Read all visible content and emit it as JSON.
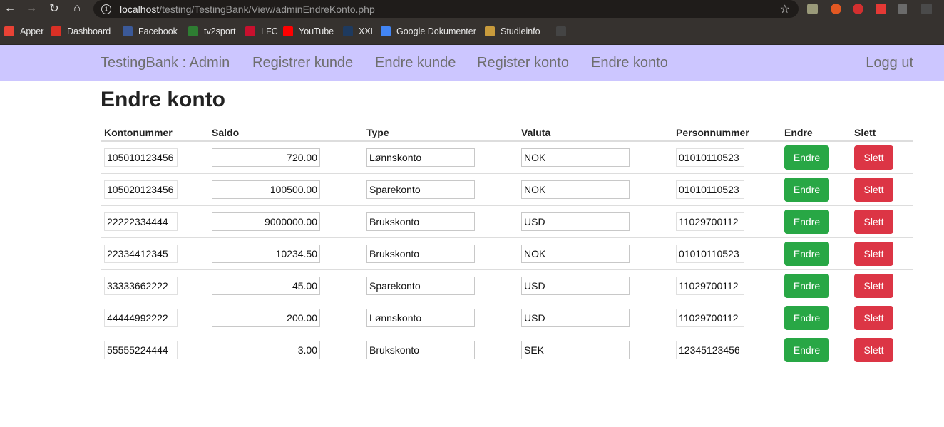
{
  "browser": {
    "url_host": "localhost",
    "url_path": "/testing/TestingBank/View/adminEndreKonto.php",
    "bookmarks": [
      {
        "label": "Apper",
        "color": "#e94235"
      },
      {
        "label": "Dashboard",
        "color": "#d93025"
      },
      {
        "label": "Facebook",
        "color": "#3b5998"
      },
      {
        "label": "tv2sport",
        "color": "#2e7d32"
      },
      {
        "label": "LFC",
        "color": "#c8102e"
      },
      {
        "label": "YouTube",
        "color": "#ff0000"
      },
      {
        "label": "XXL",
        "color": "#1e3a5f"
      },
      {
        "label": "Google Dokumenter",
        "color": "#4285f4"
      },
      {
        "label": "Studieinfo",
        "color": "#c89b3c"
      },
      {
        "label": "",
        "color": "#444444"
      }
    ]
  },
  "navbar": {
    "brand": "TestingBank : Admin",
    "links": [
      "Registrer kunde",
      "Endre kunde",
      "Register konto",
      "Endre konto"
    ],
    "logout": "Logg ut"
  },
  "page": {
    "title": "Endre konto"
  },
  "table": {
    "headers": [
      "Kontonummer",
      "Saldo",
      "Type",
      "Valuta",
      "Personnummer",
      "Endre",
      "Slett"
    ],
    "edit_label": "Endre",
    "delete_label": "Slett",
    "rows": [
      {
        "konto": "105010123456",
        "saldo": "720.00",
        "type": "Lønnskonto",
        "valuta": "NOK",
        "pnr": "01010110523"
      },
      {
        "konto": "105020123456",
        "saldo": "100500.00",
        "type": "Sparekonto",
        "valuta": "NOK",
        "pnr": "01010110523"
      },
      {
        "konto": "22222334444",
        "saldo": "9000000.00",
        "type": "Brukskonto",
        "valuta": "USD",
        "pnr": "11029700112"
      },
      {
        "konto": "22334412345",
        "saldo": "10234.50",
        "type": "Brukskonto",
        "valuta": "NOK",
        "pnr": "01010110523"
      },
      {
        "konto": "33333662222",
        "saldo": "45.00",
        "type": "Sparekonto",
        "valuta": "USD",
        "pnr": "11029700112"
      },
      {
        "konto": "44444992222",
        "saldo": "200.00",
        "type": "Lønnskonto",
        "valuta": "USD",
        "pnr": "11029700112"
      },
      {
        "konto": "55555224444",
        "saldo": "3.00",
        "type": "Brukskonto",
        "valuta": "SEK",
        "pnr": "12345123456"
      }
    ]
  },
  "colors": {
    "navbar_bg": "#ccc6ff",
    "endre_button": "#28a745",
    "slett_button": "#dc3545"
  }
}
